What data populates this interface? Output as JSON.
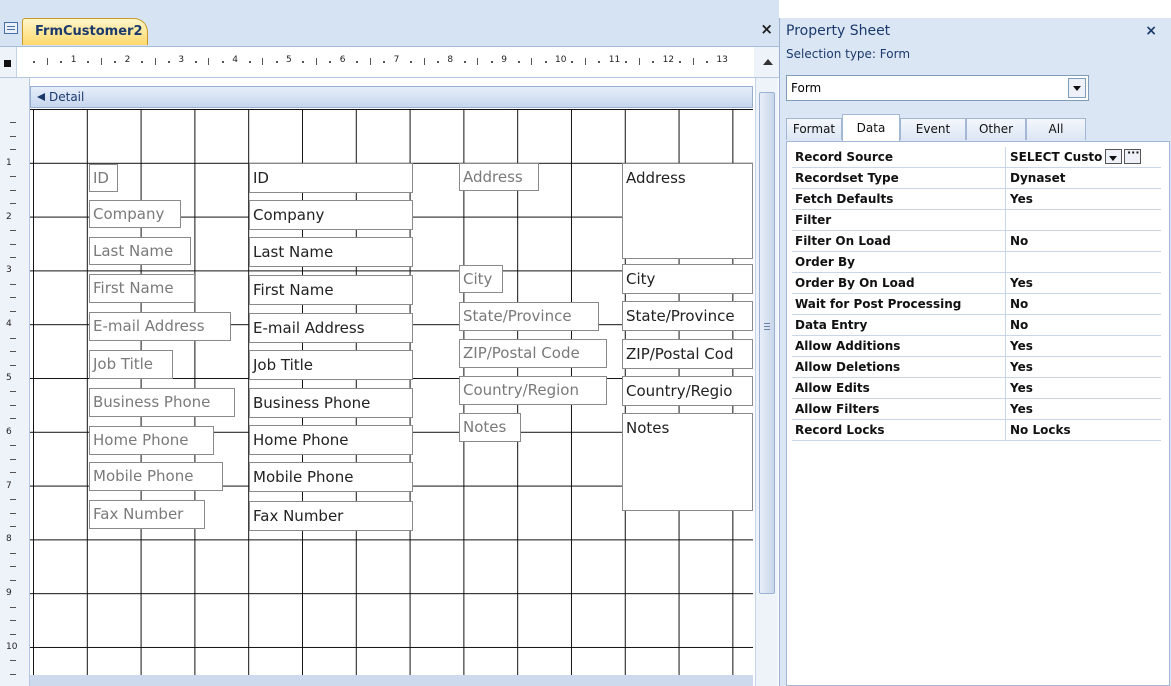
{
  "document": {
    "tab_title": "FrmCustomer2",
    "close_label": "×"
  },
  "ruler": {
    "numbers": [
      "1",
      "2",
      "3",
      "4",
      "5",
      "6",
      "7",
      "8",
      "9",
      "10",
      "11",
      "12",
      "13"
    ],
    "v_numbers": [
      "1",
      "2",
      "3",
      "4",
      "5",
      "6",
      "7",
      "8",
      "9",
      "10"
    ]
  },
  "detail": {
    "label": "Detail"
  },
  "controls": {
    "left_labels": [
      "ID",
      "Company",
      "Last Name",
      "First Name",
      "E-mail Address",
      "Job Title",
      "Business Phone",
      "Home Phone",
      "Mobile Phone",
      "Fax Number"
    ],
    "left_textboxes": [
      "ID",
      "Company",
      "Last Name",
      "First Name",
      "E-mail Address",
      "Job Title",
      "Business Phone",
      "Home Phone",
      "Mobile Phone",
      "Fax Number"
    ],
    "right_labels": [
      "Address",
      "City",
      "State/Province",
      "ZIP/Postal Code",
      "Country/Region",
      "Notes"
    ],
    "right_textboxes": [
      "Address",
      "City",
      "State/Province",
      "ZIP/Postal Cod",
      "Country/Regio",
      "Notes"
    ]
  },
  "property_sheet": {
    "title": "Property Sheet",
    "close_label": "×",
    "selection_type": "Selection type:  Form",
    "selected_object": "Form",
    "tabs": [
      "Format",
      "Data",
      "Event",
      "Other",
      "All"
    ],
    "active_tab": "Data",
    "rows": [
      {
        "name": "Record Source",
        "value": "SELECT Custo"
      },
      {
        "name": "Recordset Type",
        "value": "Dynaset"
      },
      {
        "name": "Fetch Defaults",
        "value": "Yes"
      },
      {
        "name": "Filter",
        "value": ""
      },
      {
        "name": "Filter On Load",
        "value": "No"
      },
      {
        "name": "Order By",
        "value": ""
      },
      {
        "name": "Order By On Load",
        "value": "Yes"
      },
      {
        "name": "Wait for Post Processing",
        "value": "No"
      },
      {
        "name": "Data Entry",
        "value": "No"
      },
      {
        "name": "Allow Additions",
        "value": "Yes"
      },
      {
        "name": "Allow Deletions",
        "value": "Yes"
      },
      {
        "name": "Allow Edits",
        "value": "Yes"
      },
      {
        "name": "Allow Filters",
        "value": "Yes"
      },
      {
        "name": "Record Locks",
        "value": "No Locks"
      }
    ]
  },
  "colors": {
    "accent": "#1b3a6b",
    "tab_active": "#ffd86b",
    "panel": "#dbe6f5"
  }
}
